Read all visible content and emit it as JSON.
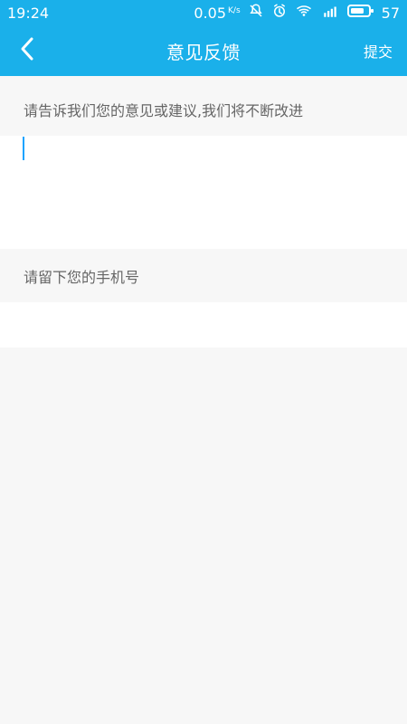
{
  "status_bar": {
    "time": "19:24",
    "network_rate": "0.05",
    "network_rate_unit": "K/s",
    "battery": "57",
    "icons": [
      "bell-off-icon",
      "alarm-icon",
      "wifi-icon",
      "signal-4g-icon",
      "battery-icon"
    ]
  },
  "app_bar": {
    "title": "意见反馈",
    "submit_label": "提交",
    "color": "#1ab0ea"
  },
  "feedback": {
    "label": "请告诉我们您的意见或建议,我们将不断改进",
    "value": "",
    "placeholder": ""
  },
  "phone": {
    "label": "请留下您的手机号",
    "value": "",
    "placeholder": ""
  }
}
